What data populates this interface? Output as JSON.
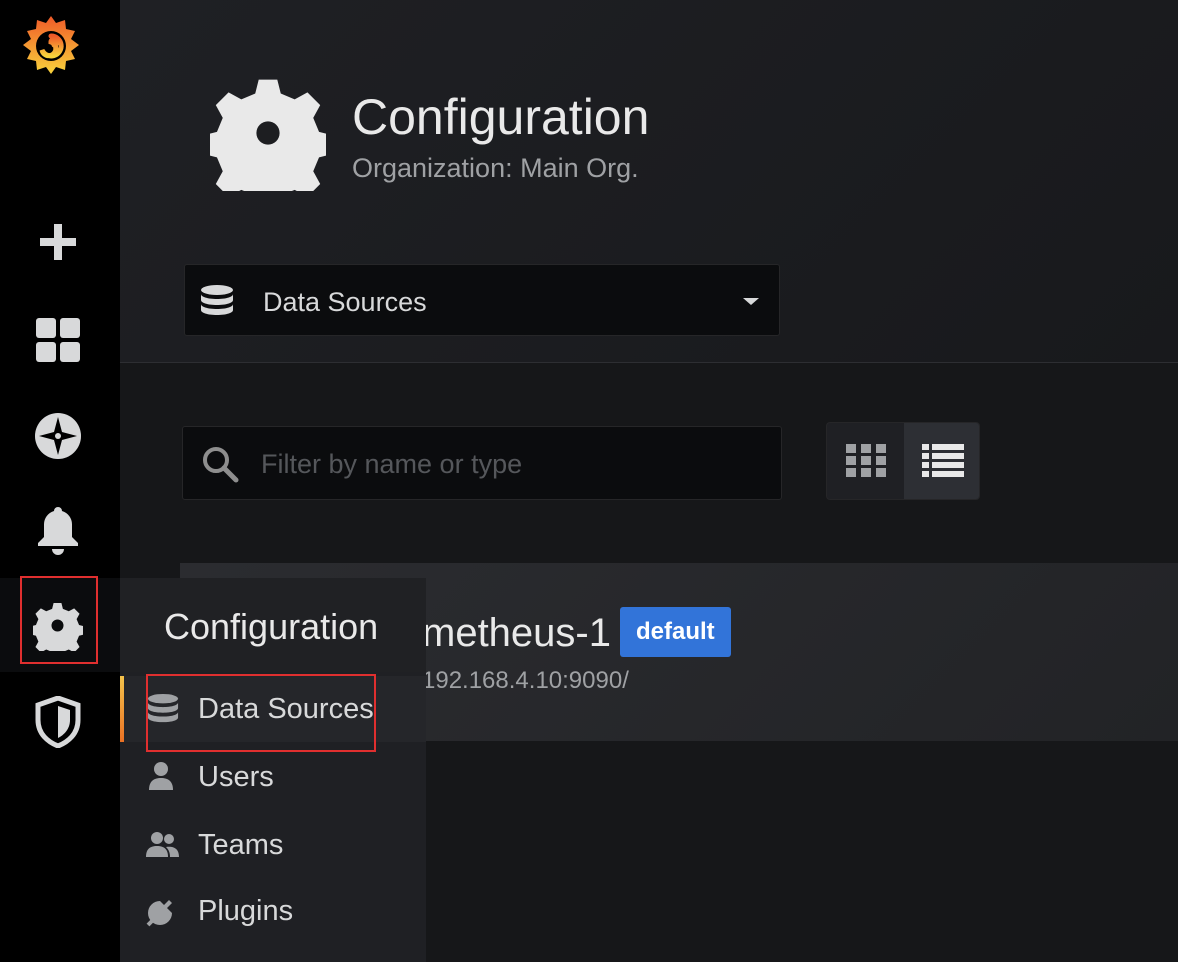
{
  "sidebar": {
    "items": [
      {
        "name": "create-icon"
      },
      {
        "name": "dashboards-icon"
      },
      {
        "name": "explore-icon"
      },
      {
        "name": "alerting-icon"
      },
      {
        "name": "configuration-icon",
        "active": true
      },
      {
        "name": "server-admin-icon"
      }
    ]
  },
  "header": {
    "title": "Configuration",
    "subtitle": "Organization: Main Org.",
    "nav_select": "Data Sources"
  },
  "toolbar": {
    "search_placeholder": "Filter by name or type"
  },
  "datasource": {
    "name_visible": "metheus-1",
    "badge": "default",
    "url_visible": "192.168.4.10:9090/"
  },
  "config_menu": {
    "title": "Configuration",
    "items": [
      {
        "label": "Data Sources",
        "icon": "database-icon",
        "active": true
      },
      {
        "label": "Users",
        "icon": "user-icon"
      },
      {
        "label": "Teams",
        "icon": "teams-icon"
      },
      {
        "label": "Plugins",
        "icon": "plug-icon"
      }
    ]
  },
  "colors": {
    "accent_badge": "#3274d9",
    "highlight_box": "#e02f2f",
    "active_bar": "#f4c34b"
  }
}
